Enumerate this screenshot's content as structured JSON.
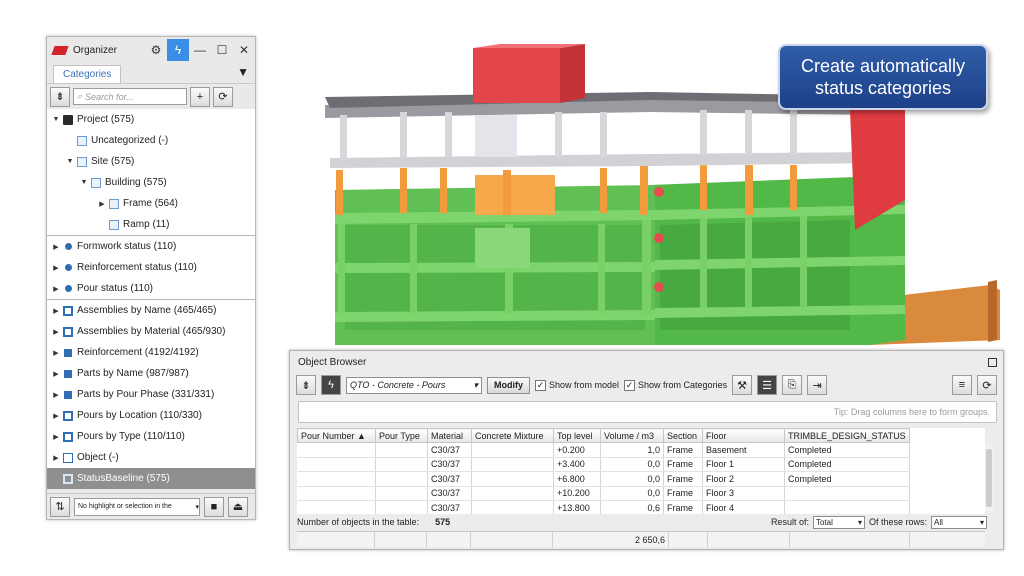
{
  "callout": {
    "line1": "Create automatically",
    "line2": "status categories"
  },
  "organizer": {
    "title": "Organizer",
    "tab": "Categories",
    "search_placeholder": "Search for...",
    "tree": [
      {
        "label": "Project (575)",
        "icon": "project-icon"
      },
      {
        "label": "Uncategorized (-)",
        "icon": "box-icon"
      },
      {
        "label": "Site (575)",
        "icon": "box-icon"
      },
      {
        "label": "Building (575)",
        "icon": "box-icon"
      },
      {
        "label": "Frame (564)",
        "icon": "box-icon"
      },
      {
        "label": "Ramp (11)",
        "icon": "box-icon"
      },
      {
        "label": "Formwork status (110)",
        "icon": "dot-icon"
      },
      {
        "label": "Reinforcement status (110)",
        "icon": "dot-icon"
      },
      {
        "label": "Pour status (110)",
        "icon": "dot-icon"
      },
      {
        "label": "Assemblies by Name (465/465)",
        "icon": "network-icon"
      },
      {
        "label": "Assemblies by Material (465/930)",
        "icon": "network-icon"
      },
      {
        "label": "Reinforcement (4192/4192)",
        "icon": "square-icon"
      },
      {
        "label": "Parts by Name (987/987)",
        "icon": "square-icon"
      },
      {
        "label": "Parts by Pour Phase (331/331)",
        "icon": "square-icon"
      },
      {
        "label": "Pours by Location (110/330)",
        "icon": "network-icon"
      },
      {
        "label": "Pours by Type (110/110)",
        "icon": "network-icon"
      },
      {
        "label": "Object (-)",
        "icon": "ring-icon"
      },
      {
        "label": "StatusBaseline (575)",
        "icon": "network-icon"
      }
    ],
    "highlight_dropdown": "No highlight or selection in the"
  },
  "browser": {
    "title": "Object Browser",
    "query": "QTO - Concrete - Pours",
    "modify": "Modify",
    "show_from_model": "Show from model",
    "show_from_categories": "Show from Categories",
    "group_tip": "Tip: Drag columns here to form groups.",
    "columns": [
      "Pour Number",
      "Pour Type",
      "Material",
      "Concrete Mixture",
      "Top level",
      "Volume / m3",
      "Section",
      "Floor",
      "TRIMBLE_DESIGN_STATUS"
    ],
    "rows": [
      [
        "",
        "",
        "C30/37",
        "",
        "+0.200",
        "1,0",
        "Frame",
        "Basement",
        "Completed"
      ],
      [
        "",
        "",
        "C30/37",
        "",
        "+3.400",
        "0,0",
        "Frame",
        "Floor 1",
        "Completed"
      ],
      [
        "",
        "",
        "C30/37",
        "",
        "+6.800",
        "0,0",
        "Frame",
        "Floor 2",
        "Completed"
      ],
      [
        "",
        "",
        "C30/37",
        "",
        "+10.200",
        "0,0",
        "Frame",
        "Floor 3",
        ""
      ],
      [
        "",
        "",
        "C30/37",
        "",
        "+13.800",
        "0,6",
        "Frame",
        "Floor 4",
        ""
      ]
    ],
    "count_label": "Number of objects in the table:",
    "count_value": "575",
    "result_of_label": "Result of:",
    "result_of_value": "Total",
    "of_these_rows_label": "Of these rows:",
    "of_these_rows_value": "All",
    "total_volume": "2 650,6"
  },
  "colors": {
    "completed": "#5cb85c",
    "in_progress": "#f5a142",
    "not_started": "#e64b4f",
    "slab": "#c7c7cb",
    "ramp": "#d9893f"
  }
}
